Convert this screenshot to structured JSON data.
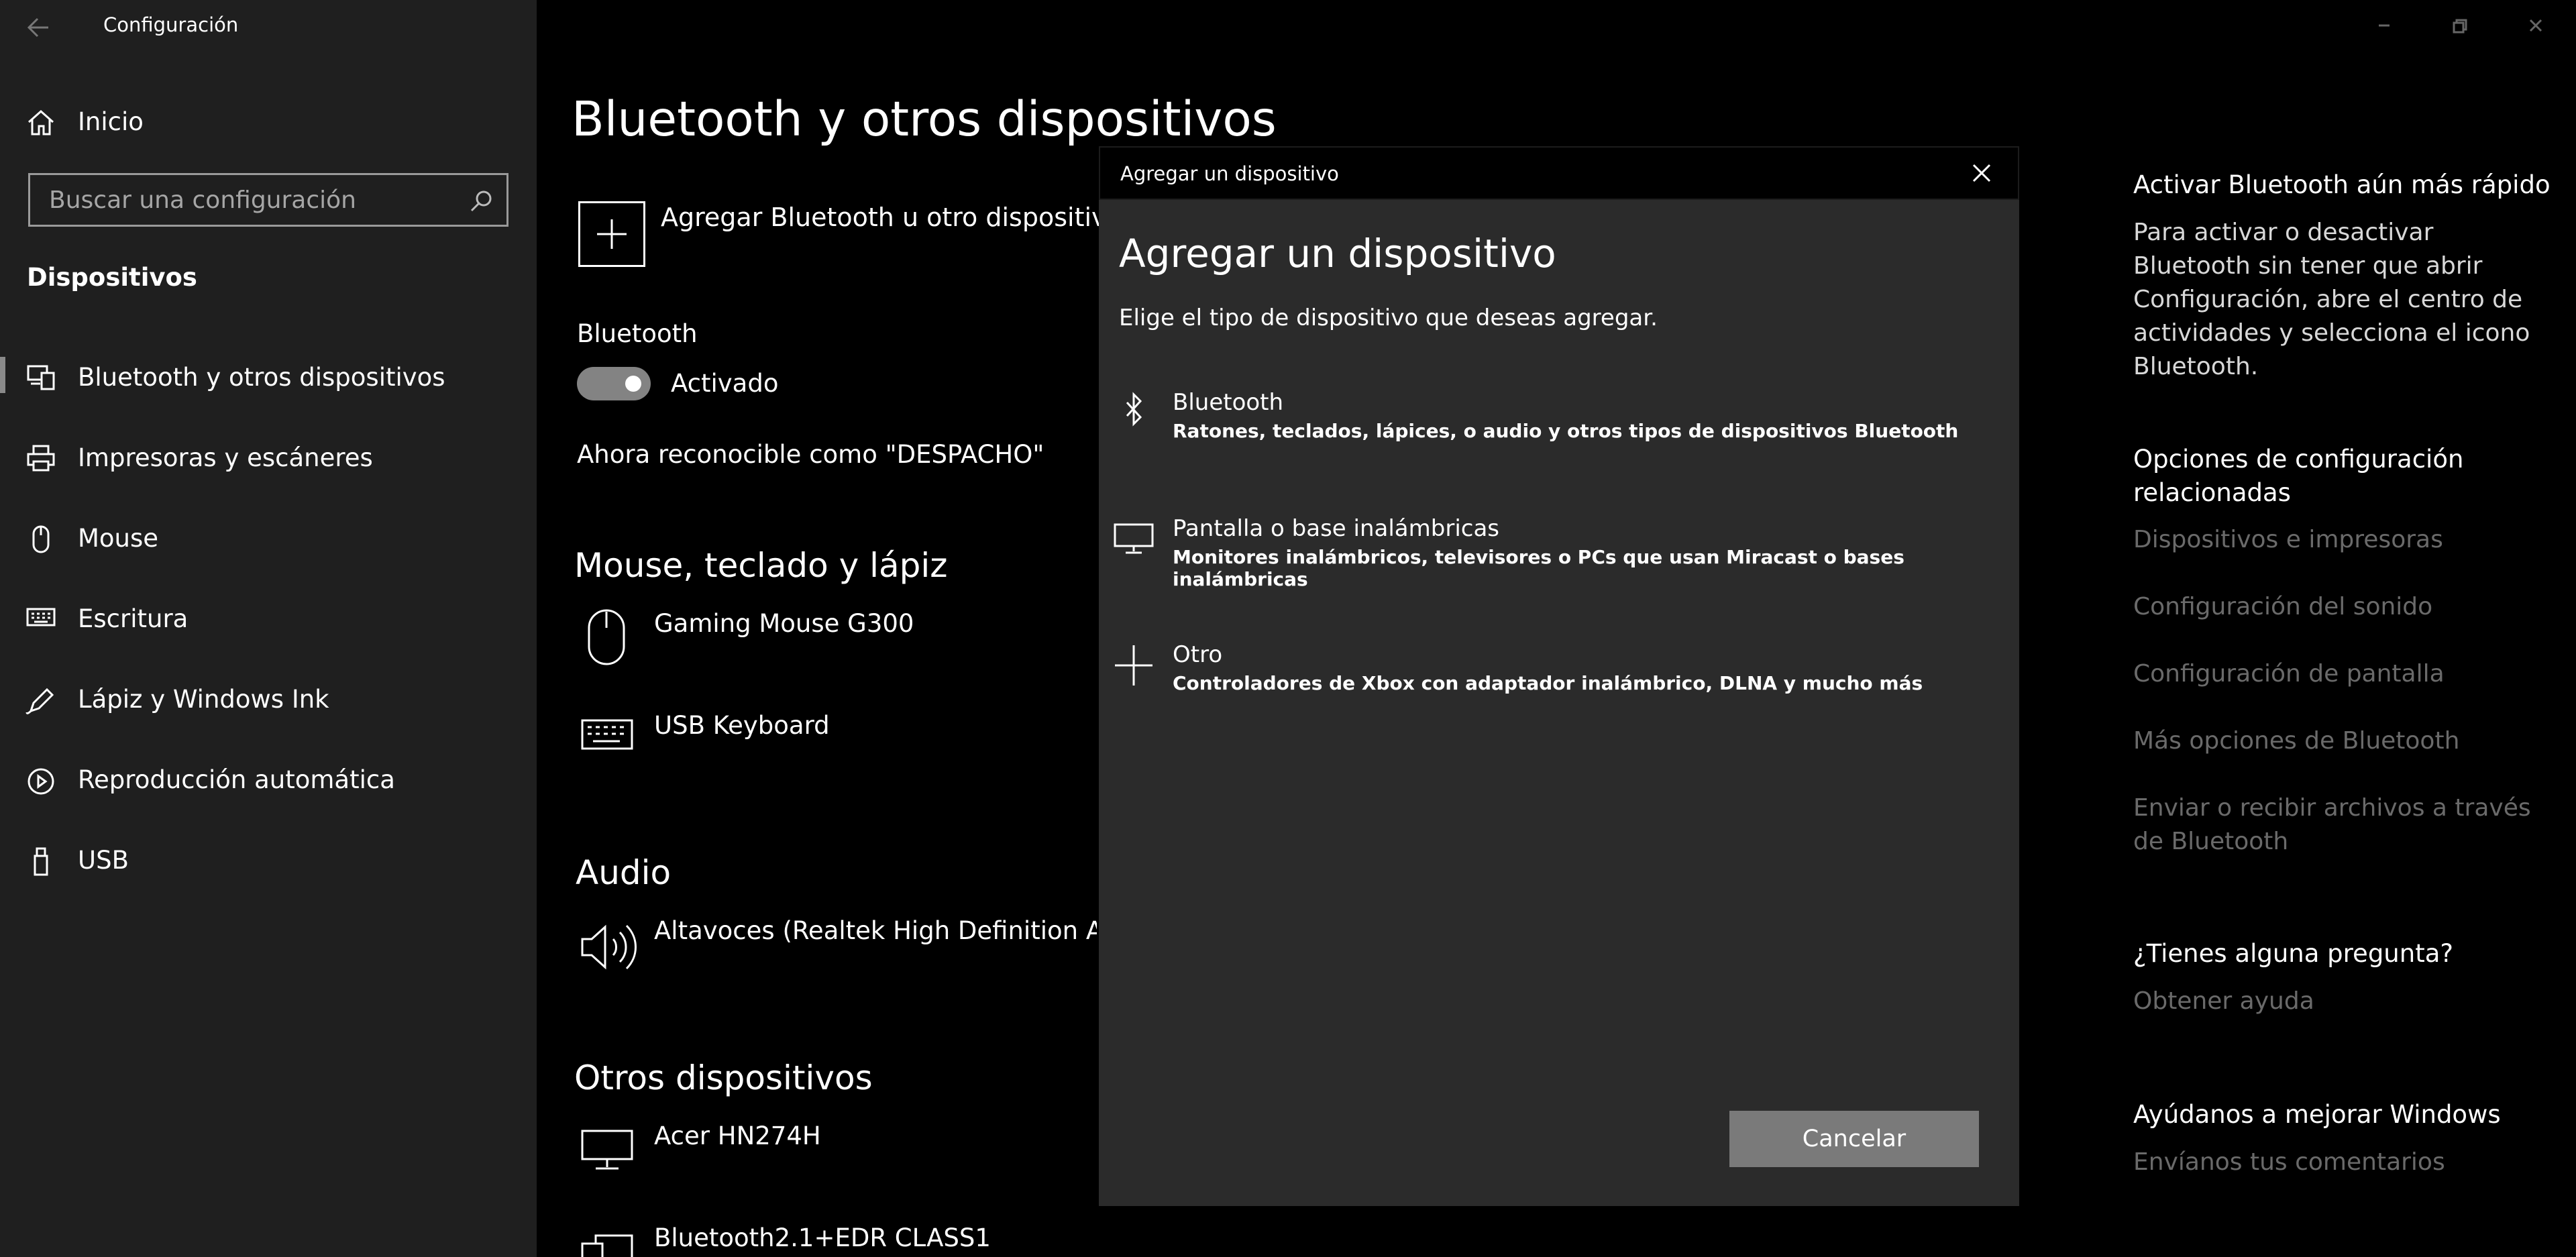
{
  "window": {
    "app_title": "Configuración"
  },
  "sidebar": {
    "home": "Inicio",
    "search_placeholder": "Buscar una configuración",
    "section_title": "Dispositivos",
    "items": [
      {
        "label": "Bluetooth y otros dispositivos",
        "icon": "bluetooth-devices-icon",
        "selected": true
      },
      {
        "label": "Impresoras y escáneres",
        "icon": "printer-icon"
      },
      {
        "label": "Mouse",
        "icon": "mouse-icon"
      },
      {
        "label": "Escritura",
        "icon": "keyboard-icon"
      },
      {
        "label": "Lápiz y Windows Ink",
        "icon": "pen-icon"
      },
      {
        "label": "Reproducción automática",
        "icon": "autoplay-icon"
      },
      {
        "label": "USB",
        "icon": "usb-icon"
      }
    ]
  },
  "main": {
    "title": "Bluetooth y otros dispositivos",
    "add_device": "Agregar Bluetooth u otro dispositivo",
    "bluetooth_label": "Bluetooth",
    "bluetooth_state": "Activado",
    "bluetooth_on": true,
    "discoverable": "Ahora reconocible como \"DESPACHO\"",
    "sections": {
      "mouse_keyboard": {
        "title": "Mouse, teclado y lápiz",
        "devices": [
          "Gaming Mouse G300",
          "USB Keyboard"
        ]
      },
      "audio": {
        "title": "Audio",
        "devices": [
          "Altavoces (Realtek High Definition Audio"
        ]
      },
      "other": {
        "title": "Otros dispositivos",
        "devices": [
          "Acer HN274H",
          "Bluetooth2.1+EDR CLASS1"
        ]
      }
    }
  },
  "dialog": {
    "window_title": "Agregar un dispositivo",
    "heading": "Agregar un dispositivo",
    "subtitle": "Elige el tipo de dispositivo que deseas agregar.",
    "options": [
      {
        "title": "Bluetooth",
        "desc": "Ratones, teclados, lápices, o audio y otros tipos de dispositivos Bluetooth",
        "icon": "bluetooth-icon"
      },
      {
        "title": "Pantalla o base inalámbricas",
        "desc": "Monitores inalámbricos, televisores o PCs que usan Miracast o bases inalámbricas",
        "icon": "monitor-icon"
      },
      {
        "title": "Otro",
        "desc": "Controladores de Xbox con adaptador inalámbrico, DLNA y mucho más",
        "icon": "plus-icon"
      }
    ],
    "cancel": "Cancelar"
  },
  "right": {
    "fast_title": "Activar Bluetooth aún más rápido",
    "fast_text": "Para activar o desactivar Bluetooth sin tener que abrir Configuración, abre el centro de actividades y selecciona el icono Bluetooth.",
    "related_title": "Opciones de configuración relacionadas",
    "related_links": [
      "Dispositivos e impresoras",
      "Configuración del sonido",
      "Configuración de pantalla",
      "Más opciones de Bluetooth",
      "Enviar o recibir archivos a través de Bluetooth"
    ],
    "question_title": "¿Tienes alguna pregunta?",
    "help_link": "Obtener ayuda",
    "improve_title": "Ayúdanos a mejorar Windows",
    "feedback_link": "Envíanos tus comentarios"
  }
}
